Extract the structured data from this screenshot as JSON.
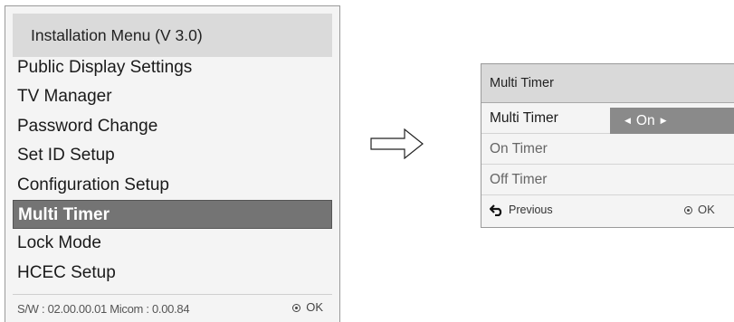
{
  "install_menu": {
    "title": "Installation Menu (V 3.0)",
    "items": [
      {
        "label": "Public Display Settings"
      },
      {
        "label": "TV Manager"
      },
      {
        "label": "Password Change"
      },
      {
        "label": "Set ID Setup"
      },
      {
        "label": "Configuration Setup"
      },
      {
        "label": "Multi Timer",
        "selected": true
      },
      {
        "label": "Lock Mode"
      },
      {
        "label": "HCEC Setup"
      }
    ],
    "footer": {
      "sw_info": "S/W : 02.00.00.01 Micom : 0.00.84",
      "ok_label": "OK"
    }
  },
  "timer_dialog": {
    "title": "Multi Timer",
    "rows": [
      {
        "label": "Multi Timer",
        "value": "On"
      },
      {
        "label": "On Timer"
      },
      {
        "label": "Off Timer"
      }
    ],
    "footer": {
      "previous_label": "Previous",
      "ok_label": "OK"
    }
  },
  "icons": {
    "arrow": "right-arrow-icon",
    "ok": "ok-dot-icon",
    "back": "back-arrow-icon",
    "value_left": "triangle-left-icon",
    "value_right": "triangle-right-icon"
  },
  "colors": {
    "selected_item_bg": "#747474",
    "value_box_bg": "#8a8a8a",
    "title_bar_bg": "#dadada",
    "panel_bg": "#f4f4f4"
  }
}
